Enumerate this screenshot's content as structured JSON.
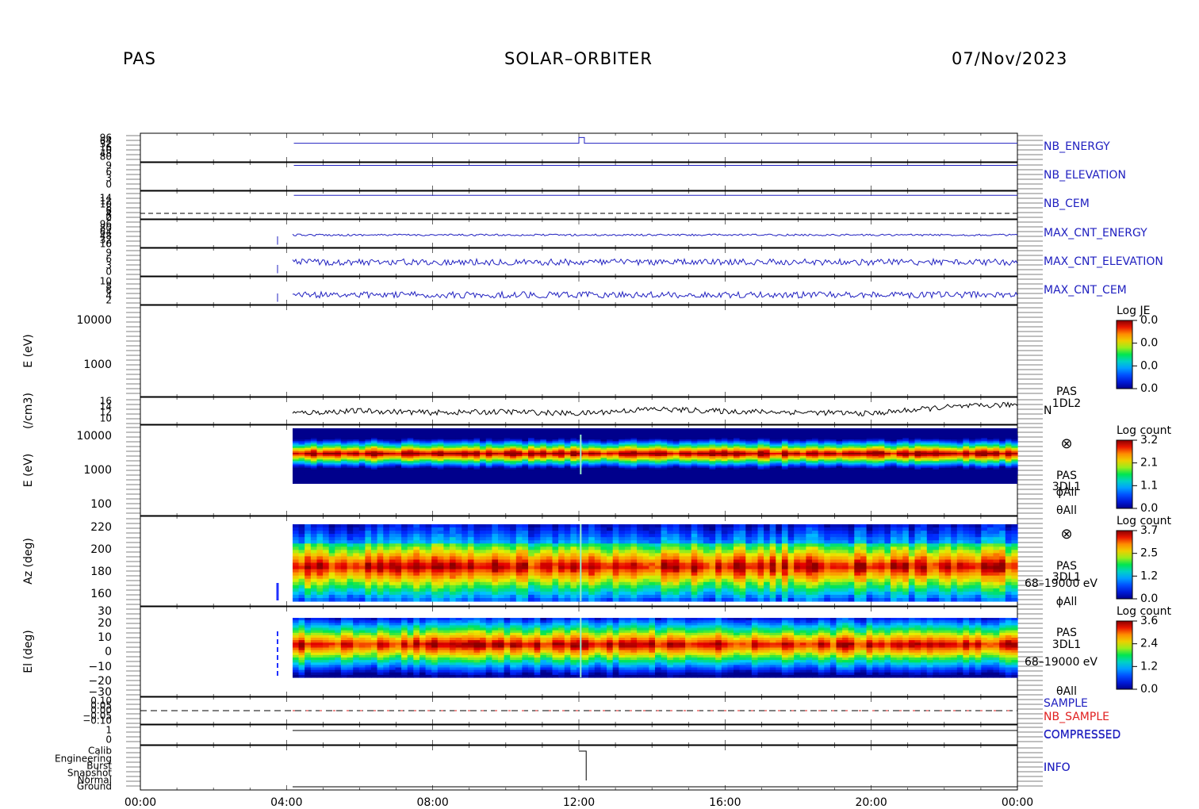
{
  "header": {
    "instrument": "PAS",
    "mission": "SOLAR–ORBITER",
    "date": "07/Nov/2023"
  },
  "chart_data": {
    "type": "heatmap",
    "x_tick_labels": [
      "00:00",
      "04:00",
      "08:00",
      "12:00",
      "16:00",
      "20:00",
      "00:00"
    ],
    "x_range_hours": [
      0,
      24
    ],
    "panels": [
      {
        "id": "nb-energy",
        "type": "line",
        "label": "NB_ENERGY",
        "color": "#2020c0",
        "tick_labels": [
          "96",
          "64",
          "32",
          "16",
          "0",
          "48",
          "80"
        ],
        "series": [
          {
            "x": [
              4.2,
              12.0,
              12.0,
              12.15,
              12.15,
              24.0
            ],
            "y": [
              0.35,
              0.35,
              0.15,
              0.15,
              0.35,
              0.35
            ]
          }
        ]
      },
      {
        "id": "nb-elevation",
        "type": "line",
        "label": "NB_ELEVATION",
        "color": "#2020c0",
        "tick_labels": [
          "9",
          "6",
          "3",
          "0"
        ],
        "series": [
          {
            "x": [
              4.2,
              24.0
            ],
            "y": [
              0.1,
              0.1
            ]
          }
        ]
      },
      {
        "id": "nb-cem",
        "type": "line",
        "label": "NB_CEM",
        "color": "#2020c0",
        "tick_labels": [
          "14",
          "12",
          "10",
          "8",
          "6",
          "4",
          "2",
          "0"
        ],
        "series": [
          {
            "x": [
              4.2,
              24.0
            ],
            "y": [
              0.15,
              0.15
            ]
          }
        ]
      },
      {
        "id": "max-cnt-energy",
        "type": "line",
        "label": "MAX_CNT_ENERGY",
        "color": "#2020c0",
        "tick_labels": [
          "96",
          "80",
          "64",
          "48",
          "32",
          "16",
          "0"
        ],
        "series": [
          {
            "x": [
              4.2,
              24.0
            ],
            "y": [
              0.55,
              0.55
            ]
          }
        ]
      },
      {
        "id": "max-cnt-elevation",
        "type": "line",
        "label": "MAX_CNT_ELEVATION",
        "color": "#2020c0",
        "tick_labels": [
          "9",
          "6",
          "3",
          "0"
        ],
        "series": [
          {
            "x": [
              4.2,
              24.0
            ],
            "y": [
              0.5,
              0.5
            ]
          }
        ]
      },
      {
        "id": "max-cnt-cem",
        "type": "line",
        "label": "MAX_CNT_CEM",
        "color": "#2020c0",
        "tick_labels": [
          "10",
          "8",
          "6",
          "4",
          "2"
        ],
        "series": [
          {
            "x": [
              4.2,
              24.0
            ],
            "y": [
              0.65,
              0.65
            ]
          }
        ]
      },
      {
        "id": "energy-je",
        "type": "heatmap",
        "ylabel": "E (eV)",
        "tick_labels": [
          "10000",
          "1000"
        ],
        "colorbar": {
          "title": "Log JE",
          "labels": [
            "0.0",
            "0.0",
            "0.0",
            "0.0"
          ]
        }
      },
      {
        "id": "density",
        "type": "line",
        "ylabel": "(/cm3)",
        "label": "N",
        "color": "#000000",
        "tick_labels": [
          "16",
          "14",
          "12",
          "10"
        ],
        "product": [
          "PAS",
          "1DL2"
        ],
        "series": [
          {
            "x": [
              4.2,
              6,
              8,
              10,
              12,
              14,
              16,
              18,
              20,
              22,
              24
            ],
            "y": [
              12.5,
              13.0,
              12.6,
              12.8,
              12.4,
              13.4,
              12.9,
              12.7,
              12.4,
              13.8,
              14.4
            ]
          }
        ]
      },
      {
        "id": "energy-spectrogram",
        "type": "heatmap",
        "ylabel": "E (eV)",
        "tick_labels": [
          "10000",
          "1000",
          "100"
        ],
        "product": [
          "PAS",
          "3DL1"
        ],
        "annotations": [
          "ϕAll",
          "θAll"
        ],
        "colorbar": {
          "title": "Log count",
          "labels": [
            "3.2",
            "2.1",
            "1.1",
            "0.0"
          ]
        }
      },
      {
        "id": "azimuth-spectrogram",
        "type": "heatmap",
        "ylabel": "Az (deg)",
        "tick_labels": [
          "220",
          "200",
          "180",
          "160"
        ],
        "product": [
          "PAS",
          "3DL1"
        ],
        "annotations": [
          "68–19000 eV",
          "ϕAll"
        ],
        "colorbar": {
          "title": "Log count",
          "labels": [
            "3.7",
            "2.5",
            "1.2",
            "0.0"
          ]
        }
      },
      {
        "id": "elevation-spectrogram",
        "type": "heatmap",
        "ylabel": "El (deg)",
        "tick_labels": [
          "30",
          "20",
          "10",
          "0",
          "−10",
          "−20",
          "−30"
        ],
        "product": [
          "PAS",
          "3DL1"
        ],
        "annotations": [
          "68–19000 eV",
          "θAll"
        ],
        "colorbar": {
          "title": "Log count",
          "labels": [
            "3.6",
            "2.4",
            "1.2",
            "0.0"
          ]
        }
      },
      {
        "id": "sample",
        "type": "line",
        "labels": [
          "SAMPLE",
          "NB_SAMPLE"
        ],
        "label_colors": [
          "#2020c0",
          "#e02020"
        ],
        "tick_labels": [
          "0.10",
          "0.05",
          "0.00",
          "−0.05",
          "−0.10"
        ]
      },
      {
        "id": "compressed",
        "type": "line",
        "label": "COMPRESSED",
        "color": "#2020c0",
        "tick_labels": [
          "1",
          "0"
        ]
      },
      {
        "id": "info",
        "type": "line",
        "label": "INFO",
        "color": "#2020c0",
        "tick_labels": [
          "Calib",
          "Engineering",
          "Burst",
          "Snapshot",
          "Normal",
          "Ground"
        ]
      }
    ]
  }
}
